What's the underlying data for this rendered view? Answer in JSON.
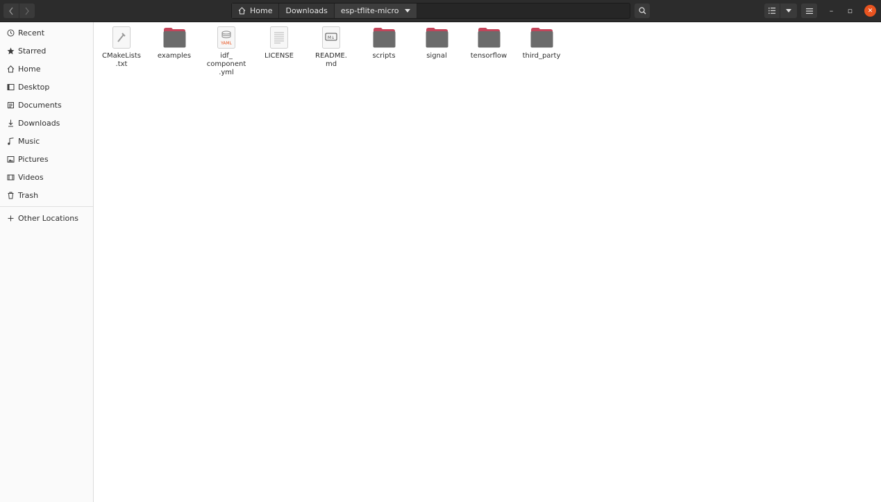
{
  "headerbar": {
    "back_icon": "chevron-left-icon",
    "forward_icon": "chevron-right-icon",
    "breadcrumbs": [
      {
        "label": "Home",
        "icon": "home-icon"
      },
      {
        "label": "Downloads"
      },
      {
        "label": "esp-tflite-micro",
        "icon": "chevron-down-icon"
      }
    ],
    "search_icon": "search-icon",
    "view_icon": "list-view-icon",
    "view_dropdown_icon": "chevron-down-icon",
    "menu_icon": "hamburger-menu-icon",
    "window_controls": {
      "minimize": "–",
      "maximize": "▫",
      "close": "✕"
    }
  },
  "sidebar": {
    "items": [
      {
        "label": "Recent",
        "icon": "clock-icon"
      },
      {
        "label": "Starred",
        "icon": "star-icon"
      },
      {
        "label": "Home",
        "icon": "home-icon"
      },
      {
        "label": "Desktop",
        "icon": "desktop-icon"
      },
      {
        "label": "Documents",
        "icon": "document-icon"
      },
      {
        "label": "Downloads",
        "icon": "download-icon"
      },
      {
        "label": "Music",
        "icon": "music-icon"
      },
      {
        "label": "Pictures",
        "icon": "picture-icon"
      },
      {
        "label": "Videos",
        "icon": "video-icon"
      },
      {
        "label": "Trash",
        "icon": "trash-icon"
      }
    ],
    "other_locations": {
      "label": "Other Locations",
      "icon": "plus-icon"
    }
  },
  "files": [
    {
      "name": "CMakeLists\n.txt",
      "type": "cmake-file"
    },
    {
      "name": "examples",
      "type": "folder"
    },
    {
      "name": "idf_\ncomponent\n.yml",
      "type": "yaml-file",
      "badge": "YAML"
    },
    {
      "name": "LICENSE",
      "type": "text-file"
    },
    {
      "name": "README.\nmd",
      "type": "markdown-file",
      "badge": "M↓"
    },
    {
      "name": "scripts",
      "type": "folder"
    },
    {
      "name": "signal",
      "type": "folder"
    },
    {
      "name": "tensorflow",
      "type": "folder"
    },
    {
      "name": "third_party",
      "type": "folder"
    }
  ],
  "colors": {
    "accent": "#e95420",
    "folder_body": "#6b6b6b",
    "folder_tab": "#c2455a"
  }
}
